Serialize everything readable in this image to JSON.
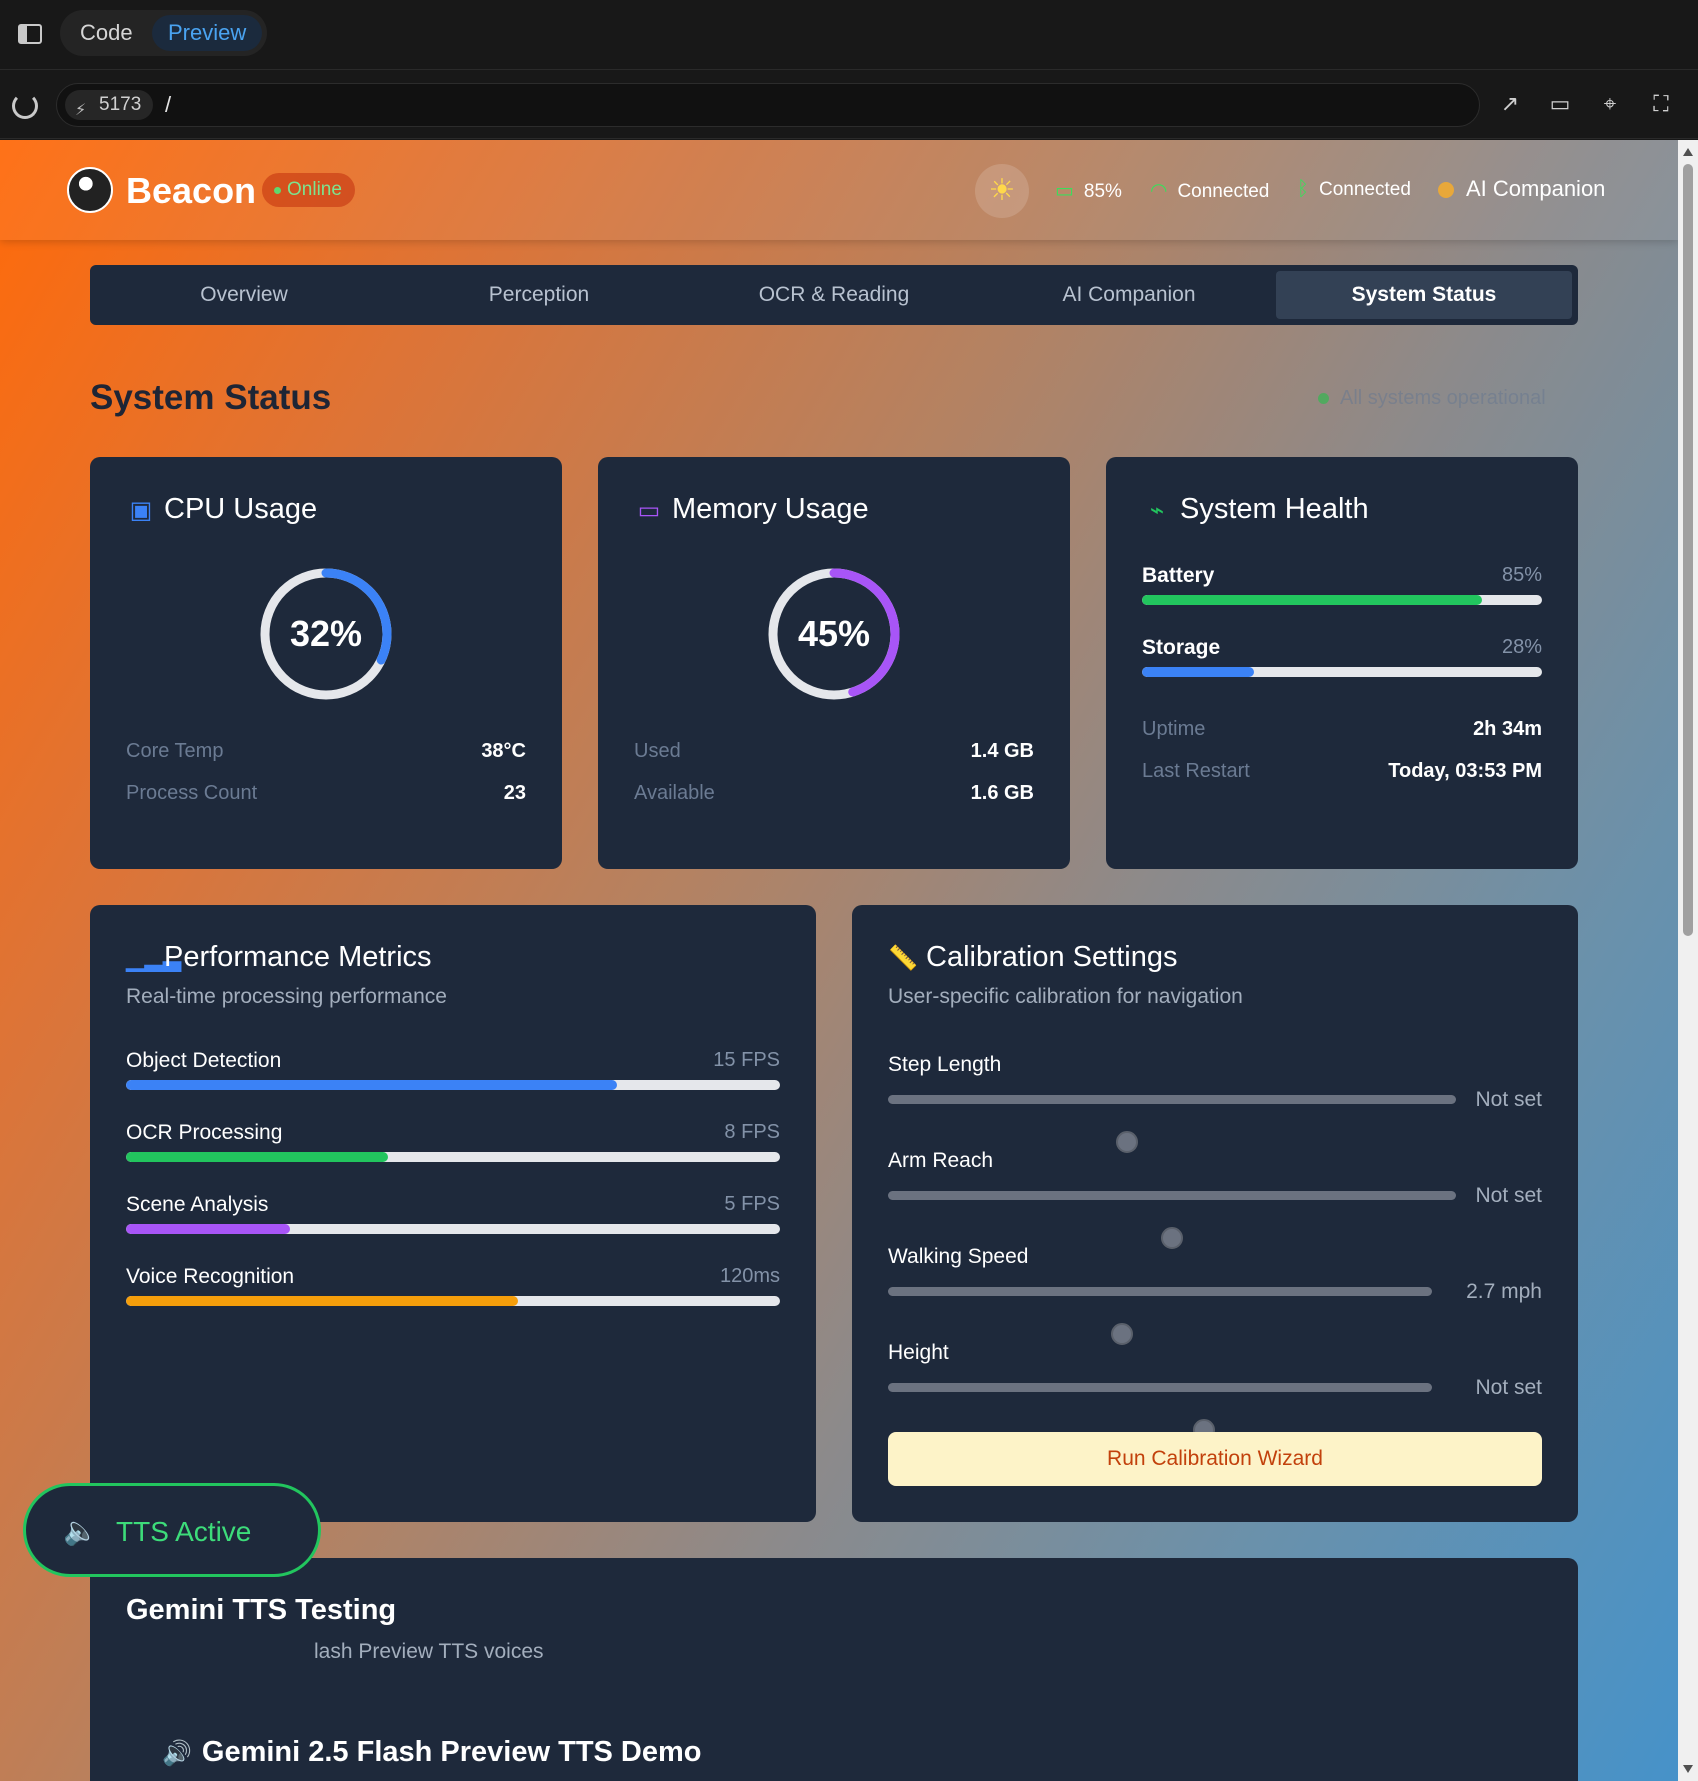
{
  "ide": {
    "tabs": {
      "code": "Code",
      "preview": "Preview"
    },
    "port": "5173",
    "path": "/"
  },
  "header": {
    "brand": "Beacon",
    "status": "Online",
    "battery": "85%",
    "wifi": "Connected",
    "bluetooth": "Connected",
    "companion": "AI Companion"
  },
  "tabs": [
    "Overview",
    "Perception",
    "OCR & Reading",
    "AI Companion",
    "System Status"
  ],
  "active_tab": 4,
  "section": {
    "title": "System Status",
    "status": "All systems operational"
  },
  "cpu": {
    "title": "CPU Usage",
    "value": "32%",
    "percent": 32,
    "rows": [
      {
        "k": "Core Temp",
        "v": "38°C"
      },
      {
        "k": "Process Count",
        "v": "23"
      }
    ],
    "color": "#3b82f6"
  },
  "memory": {
    "title": "Memory Usage",
    "value": "45%",
    "percent": 45,
    "rows": [
      {
        "k": "Used",
        "v": "1.4 GB"
      },
      {
        "k": "Available",
        "v": "1.6 GB"
      }
    ],
    "color": "#a855f7"
  },
  "health": {
    "title": "System Health",
    "bars": [
      {
        "label": "Battery",
        "value": "85%",
        "percent": 85,
        "color": "#22c55e"
      },
      {
        "label": "Storage",
        "value": "28%",
        "percent": 28,
        "color": "#3b82f6"
      }
    ],
    "rows": [
      {
        "k": "Uptime",
        "v": "2h 34m"
      },
      {
        "k": "Last Restart",
        "v": "Today, 03:53 PM"
      }
    ]
  },
  "performance": {
    "title": "Performance Metrics",
    "subtitle": "Real-time processing performance",
    "bars": [
      {
        "label": "Object Detection",
        "value": "15 FPS",
        "percent": 75,
        "color": "#3b82f6"
      },
      {
        "label": "OCR Processing",
        "value": "8 FPS",
        "percent": 40,
        "color": "#22c55e"
      },
      {
        "label": "Scene Analysis",
        "value": "5 FPS",
        "percent": 25,
        "color": "#a855f7"
      },
      {
        "label": "Voice Recognition",
        "value": "120ms",
        "percent": 60,
        "color": "#f59e0b"
      }
    ]
  },
  "calibration": {
    "title": "Calibration Settings",
    "subtitle": "User-specific calibration for navigation",
    "sliders": [
      {
        "label": "Step Length",
        "value": "Not set",
        "position": 0.42
      },
      {
        "label": "Arm Reach",
        "value": "Not set",
        "position": 0.5
      },
      {
        "label": "Walking Speed",
        "value": "2.7 mph",
        "position": 0.43
      },
      {
        "label": "Height",
        "value": "Not set",
        "position": 0.58
      }
    ],
    "button": "Run Calibration Wizard"
  },
  "tts": {
    "title": "Gemini TTS Testing",
    "subtitle_partial": "lash Preview TTS voices",
    "demo_title": "Gemini 2.5 Flash Preview TTS Demo",
    "badge": "TTS Active"
  }
}
